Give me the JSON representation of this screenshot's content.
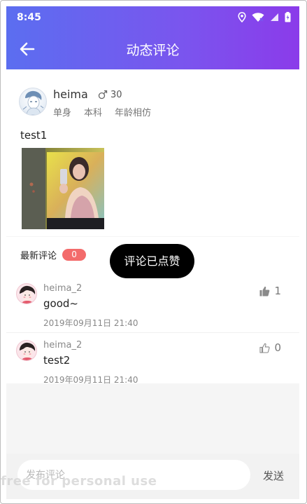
{
  "status_bar": {
    "time": "8:45",
    "icons": [
      "location-icon",
      "wifi-icon",
      "signal-icon",
      "battery-icon"
    ]
  },
  "header": {
    "title": "动态评论",
    "back_icon": "arrow-left-icon",
    "gradient_colors": [
      "#5b6ef0",
      "#8b3bea"
    ]
  },
  "post": {
    "user_name": "heima",
    "gender_icon": "male-icon",
    "age": "30",
    "tags": [
      "单身",
      "本科",
      "年龄相仿"
    ],
    "text": "test1"
  },
  "comments": {
    "title": "最新评论",
    "count": "0",
    "badge_color": "#f36b6b",
    "items": [
      {
        "user_name": "heima_2",
        "text": "good~",
        "date": "2019年09月11日 21:40",
        "likes": "1",
        "liked": true
      },
      {
        "user_name": "heima_2",
        "text": "test2",
        "date": "2019年09月11日 21:40",
        "likes": "0",
        "liked": false
      }
    ]
  },
  "toast": {
    "text": "评论已点赞"
  },
  "input_bar": {
    "placeholder": "发布评论",
    "send_label": "发送"
  },
  "watermark": "free for personal use"
}
